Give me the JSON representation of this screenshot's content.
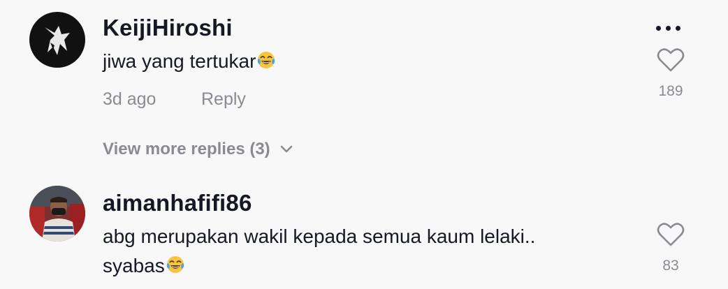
{
  "comments": [
    {
      "username": "KeijiHiroshi",
      "text": "jiwa yang tertukar",
      "emoji": "face-with-tears-of-joy",
      "time": "3d ago",
      "reply_label": "Reply",
      "likes": "189",
      "view_more": "View more replies (3)"
    },
    {
      "username": "aimanhafifi86",
      "text_line1": "abg merupakan wakil kepada semua kaum lelaki..",
      "text_line2": "syabas",
      "emoji": "face-with-tears-of-joy",
      "likes": "83"
    }
  ],
  "icons": {
    "more": "more-dots-icon",
    "like": "heart-outline-icon",
    "expand": "chevron-down-icon"
  },
  "colors": {
    "background": "#f8f8f8",
    "primary_text": "#161823",
    "secondary_text": "#8a8b91"
  }
}
